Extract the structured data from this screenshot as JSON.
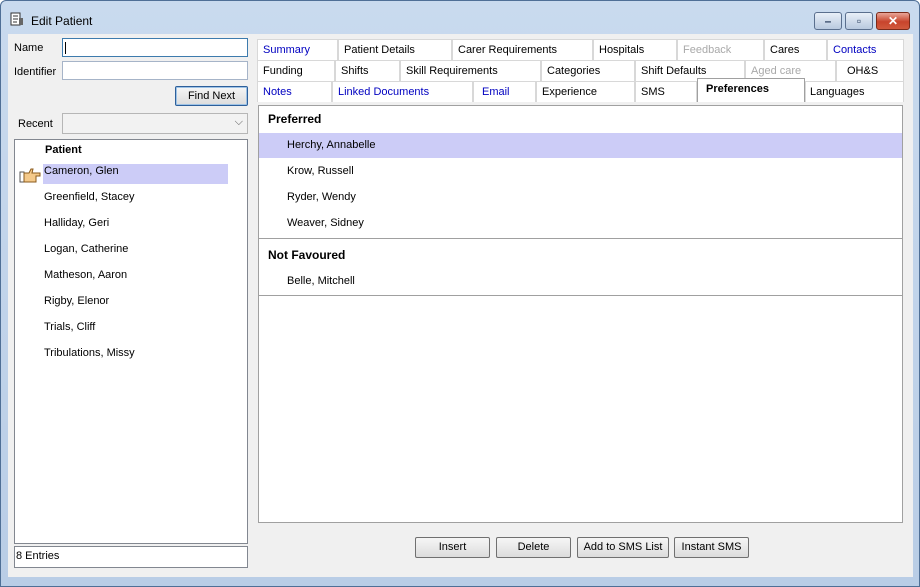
{
  "window": {
    "title": "Edit Patient",
    "close_glyph": "✕",
    "minimize_glyph": "–",
    "maximize_glyph": "▫"
  },
  "search": {
    "name_label": "Name",
    "name_value": "",
    "identifier_label": "Identifier",
    "identifier_value": "",
    "find_next_label": "Find Next",
    "recent_label": "Recent",
    "recent_value": ""
  },
  "patient_list": {
    "header": "Patient",
    "items": [
      "Cameron, Glen",
      "Greenfield, Stacey",
      "Halliday, Geri",
      "Logan, Catherine",
      "Matheson, Aaron",
      "Rigby, Elenor",
      "Trials, Cliff",
      "Tribulations, Missy"
    ],
    "selected_index": 0,
    "status": "8 Entries"
  },
  "tabs": {
    "row1": [
      "Summary",
      "Patient Details",
      "Carer Requirements",
      "Hospitals",
      "Feedback",
      "Cares",
      "Contacts"
    ],
    "row2": [
      "Funding",
      "Shifts",
      "Skill Requirements",
      "Categories",
      "Shift Defaults",
      "Aged care",
      "OH&S"
    ],
    "row3": [
      "Notes",
      "Linked Documents",
      "Email",
      "Experience",
      "SMS",
      "Preferences",
      "Languages"
    ],
    "active": "Preferences"
  },
  "preferences": {
    "preferred_title": "Preferred",
    "preferred": [
      "Herchy, Annabelle",
      "Krow, Russell",
      "Ryder, Wendy",
      "Weaver, Sidney"
    ],
    "not_favoured_title": "Not Favoured",
    "not_favoured": [
      "Belle, Mitchell"
    ]
  },
  "actions": {
    "insert": "Insert",
    "delete": "Delete",
    "add_to_sms": "Add to SMS List",
    "instant_sms": "Instant SMS"
  },
  "colors": {
    "selection": "#ccccf7",
    "link": "#0000c0",
    "disabled": "#a9a9a9"
  }
}
